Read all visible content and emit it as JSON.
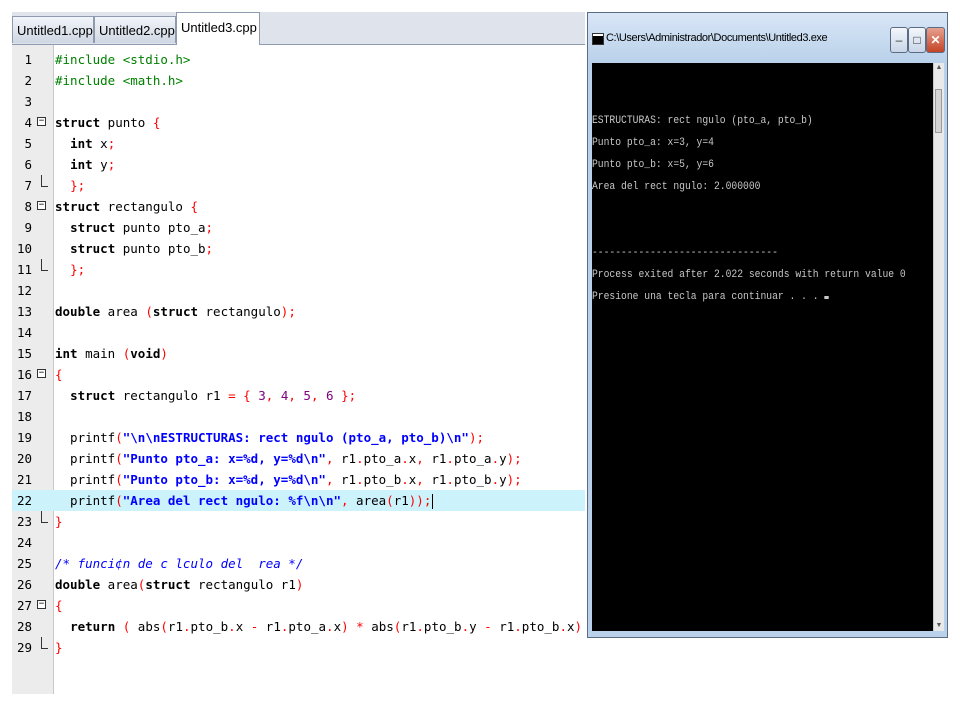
{
  "editor": {
    "tabs": [
      {
        "label": "Untitled1.cpp",
        "active": false
      },
      {
        "label": "Untitled2.cpp",
        "active": false
      },
      {
        "label": "Untitled3.cpp",
        "active": true
      }
    ],
    "lines": [
      {
        "n": "1",
        "fold": "",
        "hl": false,
        "tokens": [
          {
            "c": "pp",
            "t": "#include <stdio.h>"
          }
        ]
      },
      {
        "n": "2",
        "fold": "",
        "hl": false,
        "tokens": [
          {
            "c": "pp",
            "t": "#include <math.h>"
          }
        ]
      },
      {
        "n": "3",
        "fold": "",
        "hl": false,
        "tokens": []
      },
      {
        "n": "4",
        "fold": "open",
        "hl": false,
        "tokens": [
          {
            "c": "kw",
            "t": "struct"
          },
          {
            "c": "",
            "t": " punto "
          },
          {
            "c": "sym",
            "t": "{"
          }
        ]
      },
      {
        "n": "5",
        "fold": "",
        "hl": false,
        "tokens": [
          {
            "c": "",
            "t": "  "
          },
          {
            "c": "kw",
            "t": "int"
          },
          {
            "c": "",
            "t": " x"
          },
          {
            "c": "sym",
            "t": ";"
          }
        ]
      },
      {
        "n": "6",
        "fold": "",
        "hl": false,
        "tokens": [
          {
            "c": "",
            "t": "  "
          },
          {
            "c": "kw",
            "t": "int"
          },
          {
            "c": "",
            "t": " y"
          },
          {
            "c": "sym",
            "t": ";"
          }
        ]
      },
      {
        "n": "7",
        "fold": "end",
        "hl": false,
        "tokens": [
          {
            "c": "",
            "t": "  "
          },
          {
            "c": "sym",
            "t": "};"
          }
        ]
      },
      {
        "n": "8",
        "fold": "open",
        "hl": false,
        "tokens": [
          {
            "c": "kw",
            "t": "struct"
          },
          {
            "c": "",
            "t": " rectangulo "
          },
          {
            "c": "sym",
            "t": "{"
          }
        ]
      },
      {
        "n": "9",
        "fold": "",
        "hl": false,
        "tokens": [
          {
            "c": "",
            "t": "  "
          },
          {
            "c": "kw",
            "t": "struct"
          },
          {
            "c": "",
            "t": " punto pto_a"
          },
          {
            "c": "sym",
            "t": ";"
          }
        ]
      },
      {
        "n": "10",
        "fold": "",
        "hl": false,
        "tokens": [
          {
            "c": "",
            "t": "  "
          },
          {
            "c": "kw",
            "t": "struct"
          },
          {
            "c": "",
            "t": " punto pto_b"
          },
          {
            "c": "sym",
            "t": ";"
          }
        ]
      },
      {
        "n": "11",
        "fold": "end",
        "hl": false,
        "tokens": [
          {
            "c": "",
            "t": "  "
          },
          {
            "c": "sym",
            "t": "};"
          }
        ]
      },
      {
        "n": "12",
        "fold": "",
        "hl": false,
        "tokens": []
      },
      {
        "n": "13",
        "fold": "",
        "hl": false,
        "tokens": [
          {
            "c": "kw",
            "t": "double"
          },
          {
            "c": "",
            "t": " area "
          },
          {
            "c": "sym",
            "t": "("
          },
          {
            "c": "kw",
            "t": "struct"
          },
          {
            "c": "",
            "t": " rectangulo"
          },
          {
            "c": "sym",
            "t": ");"
          }
        ]
      },
      {
        "n": "14",
        "fold": "",
        "hl": false,
        "tokens": []
      },
      {
        "n": "15",
        "fold": "",
        "hl": false,
        "tokens": [
          {
            "c": "kw",
            "t": "int"
          },
          {
            "c": "",
            "t": " main "
          },
          {
            "c": "sym",
            "t": "("
          },
          {
            "c": "kw",
            "t": "void"
          },
          {
            "c": "sym",
            "t": ")"
          }
        ]
      },
      {
        "n": "16",
        "fold": "open",
        "hl": false,
        "tokens": [
          {
            "c": "sym",
            "t": "{"
          }
        ]
      },
      {
        "n": "17",
        "fold": "",
        "hl": false,
        "tokens": [
          {
            "c": "",
            "t": "  "
          },
          {
            "c": "kw",
            "t": "struct"
          },
          {
            "c": "",
            "t": " rectangulo r1 "
          },
          {
            "c": "sym",
            "t": "= {"
          },
          {
            "c": "",
            "t": " "
          },
          {
            "c": "num",
            "t": "3"
          },
          {
            "c": "sym",
            "t": ","
          },
          {
            "c": "",
            "t": " "
          },
          {
            "c": "num",
            "t": "4"
          },
          {
            "c": "sym",
            "t": ","
          },
          {
            "c": "",
            "t": " "
          },
          {
            "c": "num",
            "t": "5"
          },
          {
            "c": "sym",
            "t": ","
          },
          {
            "c": "",
            "t": " "
          },
          {
            "c": "num",
            "t": "6"
          },
          {
            "c": "",
            "t": " "
          },
          {
            "c": "sym",
            "t": "};"
          }
        ]
      },
      {
        "n": "18",
        "fold": "",
        "hl": false,
        "tokens": []
      },
      {
        "n": "19",
        "fold": "",
        "hl": false,
        "tokens": [
          {
            "c": "",
            "t": "  printf"
          },
          {
            "c": "sym",
            "t": "("
          },
          {
            "c": "str",
            "t": "\"\\n\\nESTRUCTURAS: rect ngulo (pto_a, pto_b)\\n\""
          },
          {
            "c": "sym",
            "t": ");"
          }
        ]
      },
      {
        "n": "20",
        "fold": "",
        "hl": false,
        "tokens": [
          {
            "c": "",
            "t": "  printf"
          },
          {
            "c": "sym",
            "t": "("
          },
          {
            "c": "str",
            "t": "\"Punto pto_a: x=%d, y=%d\\n\""
          },
          {
            "c": "sym",
            "t": ","
          },
          {
            "c": "",
            "t": " r1"
          },
          {
            "c": "sym",
            "t": "."
          },
          {
            "c": "",
            "t": "pto_a"
          },
          {
            "c": "sym",
            "t": "."
          },
          {
            "c": "",
            "t": "x"
          },
          {
            "c": "sym",
            "t": ","
          },
          {
            "c": "",
            "t": " r1"
          },
          {
            "c": "sym",
            "t": "."
          },
          {
            "c": "",
            "t": "pto_a"
          },
          {
            "c": "sym",
            "t": "."
          },
          {
            "c": "",
            "t": "y"
          },
          {
            "c": "sym",
            "t": ");"
          }
        ]
      },
      {
        "n": "21",
        "fold": "",
        "hl": false,
        "tokens": [
          {
            "c": "",
            "t": "  printf"
          },
          {
            "c": "sym",
            "t": "("
          },
          {
            "c": "str",
            "t": "\"Punto pto_b: x=%d, y=%d\\n\""
          },
          {
            "c": "sym",
            "t": ","
          },
          {
            "c": "",
            "t": " r1"
          },
          {
            "c": "sym",
            "t": "."
          },
          {
            "c": "",
            "t": "pto_b"
          },
          {
            "c": "sym",
            "t": "."
          },
          {
            "c": "",
            "t": "x"
          },
          {
            "c": "sym",
            "t": ","
          },
          {
            "c": "",
            "t": " r1"
          },
          {
            "c": "sym",
            "t": "."
          },
          {
            "c": "",
            "t": "pto_b"
          },
          {
            "c": "sym",
            "t": "."
          },
          {
            "c": "",
            "t": "y"
          },
          {
            "c": "sym",
            "t": ");"
          }
        ]
      },
      {
        "n": "22",
        "fold": "",
        "hl": true,
        "tokens": [
          {
            "c": "",
            "t": "  printf"
          },
          {
            "c": "sym",
            "t": "("
          },
          {
            "c": "str",
            "t": "\"Area del rect ngulo: %f\\n\\n\""
          },
          {
            "c": "sym",
            "t": ","
          },
          {
            "c": "",
            "t": " area"
          },
          {
            "c": "sym",
            "t": "("
          },
          {
            "c": "",
            "t": "r1"
          },
          {
            "c": "sym",
            "t": "));"
          },
          {
            "c": "caret",
            "t": ""
          }
        ]
      },
      {
        "n": "23",
        "fold": "end",
        "hl": false,
        "tokens": [
          {
            "c": "sym",
            "t": "}"
          }
        ]
      },
      {
        "n": "24",
        "fold": "",
        "hl": false,
        "tokens": []
      },
      {
        "n": "25",
        "fold": "",
        "hl": false,
        "tokens": [
          {
            "c": "cm",
            "t": "/* funci¢n de c lculo del  rea */"
          }
        ]
      },
      {
        "n": "26",
        "fold": "",
        "hl": false,
        "tokens": [
          {
            "c": "kw",
            "t": "double"
          },
          {
            "c": "",
            "t": " area"
          },
          {
            "c": "sym",
            "t": "("
          },
          {
            "c": "kw",
            "t": "struct"
          },
          {
            "c": "",
            "t": " rectangulo r1"
          },
          {
            "c": "sym",
            "t": ")"
          }
        ]
      },
      {
        "n": "27",
        "fold": "open",
        "hl": false,
        "tokens": [
          {
            "c": "sym",
            "t": "{"
          }
        ]
      },
      {
        "n": "28",
        "fold": "",
        "hl": false,
        "tokens": [
          {
            "c": "",
            "t": "  "
          },
          {
            "c": "kw",
            "t": "return"
          },
          {
            "c": "",
            "t": " "
          },
          {
            "c": "sym",
            "t": "("
          },
          {
            "c": "",
            "t": " abs"
          },
          {
            "c": "sym",
            "t": "("
          },
          {
            "c": "",
            "t": "r1"
          },
          {
            "c": "sym",
            "t": "."
          },
          {
            "c": "",
            "t": "pto_b"
          },
          {
            "c": "sym",
            "t": "."
          },
          {
            "c": "",
            "t": "x "
          },
          {
            "c": "sym",
            "t": "-"
          },
          {
            "c": "",
            "t": " r1"
          },
          {
            "c": "sym",
            "t": "."
          },
          {
            "c": "",
            "t": "pto_a"
          },
          {
            "c": "sym",
            "t": "."
          },
          {
            "c": "",
            "t": "x"
          },
          {
            "c": "sym",
            "t": ")"
          },
          {
            "c": "",
            "t": " "
          },
          {
            "c": "sym",
            "t": "*"
          },
          {
            "c": "",
            "t": " abs"
          },
          {
            "c": "sym",
            "t": "("
          },
          {
            "c": "",
            "t": "r1"
          },
          {
            "c": "sym",
            "t": "."
          },
          {
            "c": "",
            "t": "pto_b"
          },
          {
            "c": "sym",
            "t": "."
          },
          {
            "c": "",
            "t": "y "
          },
          {
            "c": "sym",
            "t": "-"
          },
          {
            "c": "",
            "t": " r1"
          },
          {
            "c": "sym",
            "t": "."
          },
          {
            "c": "",
            "t": "pto_b"
          },
          {
            "c": "sym",
            "t": "."
          },
          {
            "c": "",
            "t": "x"
          },
          {
            "c": "sym",
            "t": ")"
          },
          {
            "c": "",
            "t": " "
          },
          {
            "c": "sym",
            "t": ");"
          }
        ]
      },
      {
        "n": "29",
        "fold": "end",
        "hl": false,
        "tokens": [
          {
            "c": "sym",
            "t": "}"
          }
        ]
      }
    ]
  },
  "console": {
    "title": "C:\\Users\\Administrador\\Documents\\Untitled3.exe",
    "buttons": {
      "minimize": "–",
      "maximize": "□",
      "close": "✕"
    },
    "scroll": {
      "up": "▲",
      "down": "▼"
    },
    "lines": [
      "",
      "",
      "ESTRUCTURAS: rect ngulo (pto_a, pto_b)",
      "Punto pto_a: x=3, y=4",
      "Punto pto_b: x=5, y=6",
      "Area del rect ngulo: 2.000000",
      "",
      "",
      "--------------------------------",
      "Process exited after 2.022 seconds with return value 0",
      "Presione una tecla para continuar . . ."
    ]
  }
}
